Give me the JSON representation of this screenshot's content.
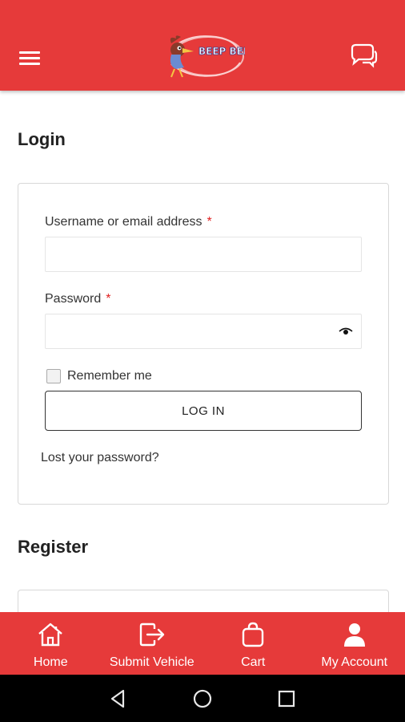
{
  "app": {
    "logo_text": "BEEP BEEP",
    "brand_color": "#e63a3a"
  },
  "header": {
    "menu_icon": "hamburger-menu-icon",
    "chat_icon": "chat-bubbles-icon"
  },
  "login": {
    "title": "Login",
    "username_label": "Username or email address",
    "username_value": "",
    "password_label": "Password",
    "password_value": "",
    "required_mark": "*",
    "remember_label": "Remember me",
    "remember_checked": false,
    "login_button": "LOG IN",
    "lost_password": "Lost your password?"
  },
  "register": {
    "title": "Register"
  },
  "bottom_nav": {
    "items": [
      {
        "label": "Home",
        "icon": "home-icon"
      },
      {
        "label": "Submit Vehicle",
        "icon": "exit-arrow-icon"
      },
      {
        "label": "Cart",
        "icon": "shopping-bag-icon"
      },
      {
        "label": "My Account",
        "icon": "user-icon"
      }
    ]
  },
  "system_nav": {
    "icons": [
      "back-icon",
      "home-circle-icon",
      "recents-square-icon"
    ]
  }
}
